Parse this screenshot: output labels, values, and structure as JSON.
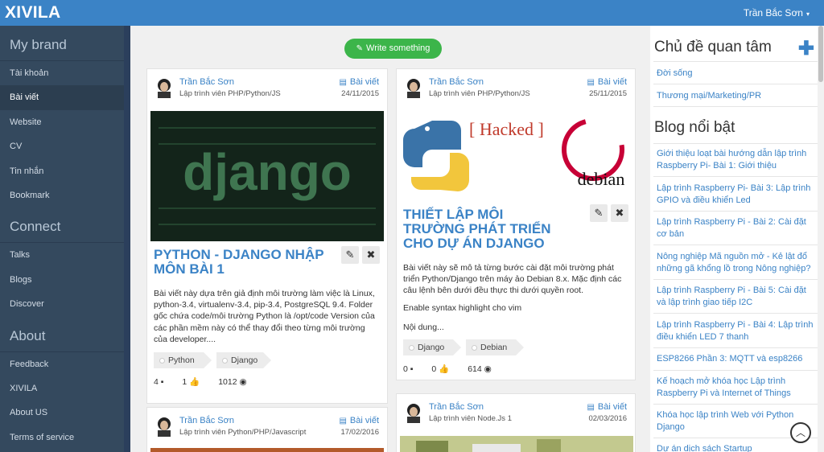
{
  "header": {
    "brand": "XIVILA",
    "user_name": "Trần Bắc Sơn",
    "caret": "▾"
  },
  "sidebar": {
    "sections": [
      {
        "title": "My brand",
        "items": [
          "Tài khoản",
          "Bài viết",
          "Website",
          "CV",
          "Tin nhắn",
          "Bookmark"
        ]
      },
      {
        "title": "Connect",
        "items": [
          "Talks",
          "Blogs",
          "Discover"
        ]
      },
      {
        "title": "About",
        "items": [
          "Feedback",
          "XIVILA",
          "About US",
          "Terms of service"
        ]
      }
    ],
    "active_item": "Bài viết"
  },
  "main": {
    "write_button": "Write something",
    "posts": [
      {
        "author": "Trần Bắc Sơn",
        "role": "Lập trình viên PHP/Python/JS",
        "type": "Bài viết",
        "date": "24/11/2015",
        "image_text": "django",
        "title": "PYTHON - DJANGO NHẬP MÔN BÀI 1",
        "desc": "Bài viết này dựa trên giả định môi trường làm việc là Linux, python-3.4, virtualenv-3.4, pip-3.4, PostgreSQL 9.4. Folder gốc chứa code/môi trường Python là /opt/code Version của các phần mềm này có thể thay đổi theo từng môi trường của developer....",
        "tags": [
          "Python",
          "Django"
        ],
        "comments": "4",
        "likes": "1",
        "views": "1012"
      },
      {
        "author": "Trần Bắc Sơn",
        "role": "Lập trình viên PHP/Python/JS",
        "type": "Bài viết",
        "date": "25/11/2015",
        "image_text": "[ Hacked ]",
        "image_text2": "debian",
        "title": "THIẾT LẬP MÔI TRƯỜNG PHÁT TRIỂN CHO DỰ ÁN DJANGO",
        "desc": "Bài viết này sẽ mô tả từng bước cài đặt môi trường phát triển Python/Django trên máy ảo Debian 8.x. Mặc định các câu lệnh bên dưới đều thực thi dưới quyền root.",
        "desc2": "Enable syntax highlight cho vim",
        "desc3": "Nội dung...",
        "tags": [
          "Django",
          "Debian"
        ],
        "comments": "0",
        "likes": "0",
        "views": "614"
      },
      {
        "author": "Trần Bắc Sơn",
        "role": "Lập trình viên Python/PHP/Javascript",
        "type": "Bài viết",
        "date": "17/02/2016"
      },
      {
        "author": "Trần Bắc Sơn",
        "role": "Lập trình viên Node.Js 1",
        "type": "Bài viết",
        "date": "02/03/2016"
      }
    ]
  },
  "right": {
    "topics_title": "Chủ đề quan tâm",
    "topics": [
      "Đời sống",
      "Thương mại/Marketing/PR"
    ],
    "featured_title": "Blog nổi bật",
    "featured": [
      "Giới thiệu loạt bài hướng dẫn lập trình Raspberry Pi- Bài 1: Giới thiệu",
      "Lập trình Raspberry Pi- Bài 3: Lập trình GPIO và điều khiển Led",
      "Lập trình Raspberry Pi - Bài 2: Cài đặt cơ bản",
      "Nông nghiệp Mã nguồn mở - Kẻ lật đổ những gã khổng lồ trong Nông nghiệp?",
      "Lập trình Raspberry Pi - Bài 5: Cài đặt và lập trình giao tiếp I2C",
      "Lập trình Raspberry Pi - Bài 4: Lập trình điều khiển LED 7 thanh",
      "ESP8266 Phần 3: MQTT và esp8266",
      "Kế hoạch mở khóa học Lập trình Raspberry Pi và Internet of Things",
      "Khóa học lập trình Web với Python Django",
      "Dự án dịch sách Startup"
    ]
  }
}
